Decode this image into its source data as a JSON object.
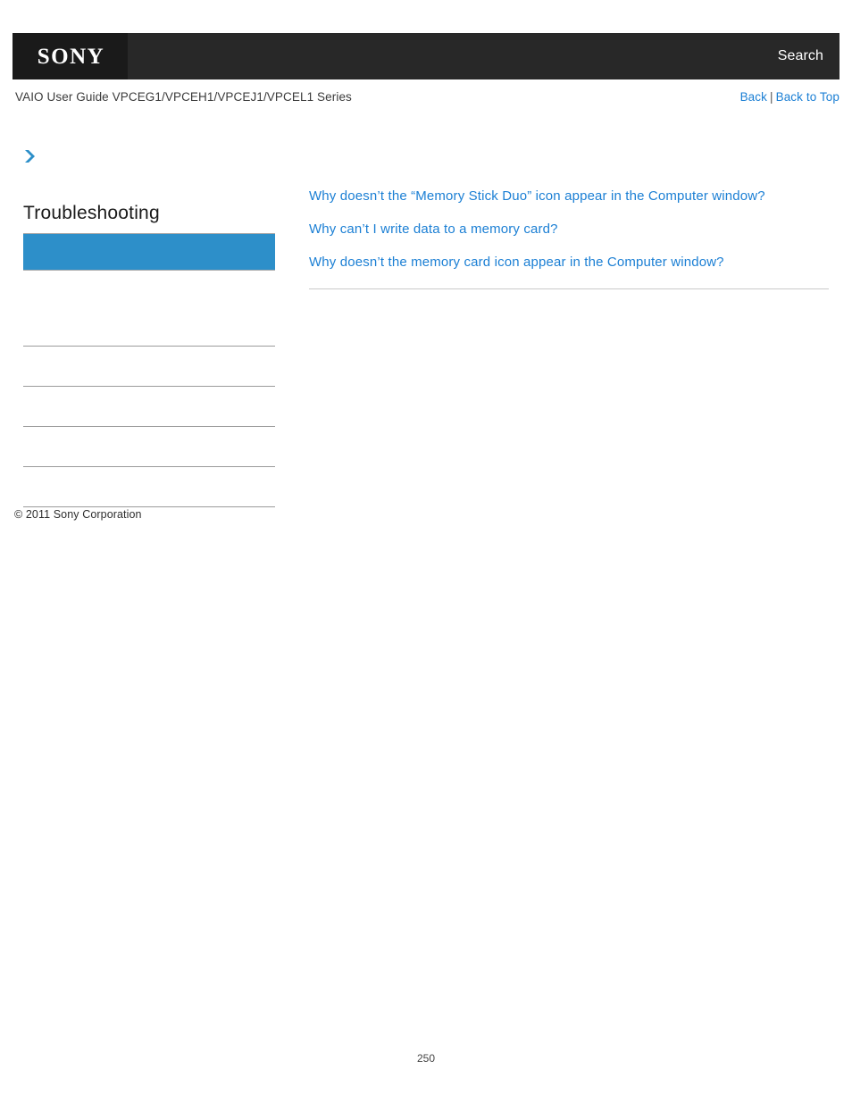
{
  "header": {
    "logo_text": "SONY",
    "search_label": "Search",
    "background_color": "#282828",
    "logo_block_color": "#1a1a1a"
  },
  "titlebar": {
    "guide_title": "VAIO User Guide VPCEG1/VPCEH1/VPCEJ1/VPCEL1 Series",
    "back_label": "Back",
    "separator": "|",
    "back_to_top_label": "Back to Top",
    "link_color": "#1b7fd4"
  },
  "sidebar": {
    "heading": "Troubleshooting",
    "active_item_color": "#2d8fc9",
    "items": [
      {
        "label": ""
      },
      {
        "label": ""
      },
      {
        "label": ""
      },
      {
        "label": ""
      },
      {
        "label": ""
      },
      {
        "label": ""
      }
    ]
  },
  "main": {
    "links": [
      "Why doesn’t the “Memory Stick Duo” icon appear in the Computer window?",
      "Why can’t I write data to a memory card?",
      "Why doesn’t the memory card icon appear in the Computer window?"
    ]
  },
  "footer": {
    "copyright": "© 2011 Sony Corporation",
    "page_number": "250"
  }
}
